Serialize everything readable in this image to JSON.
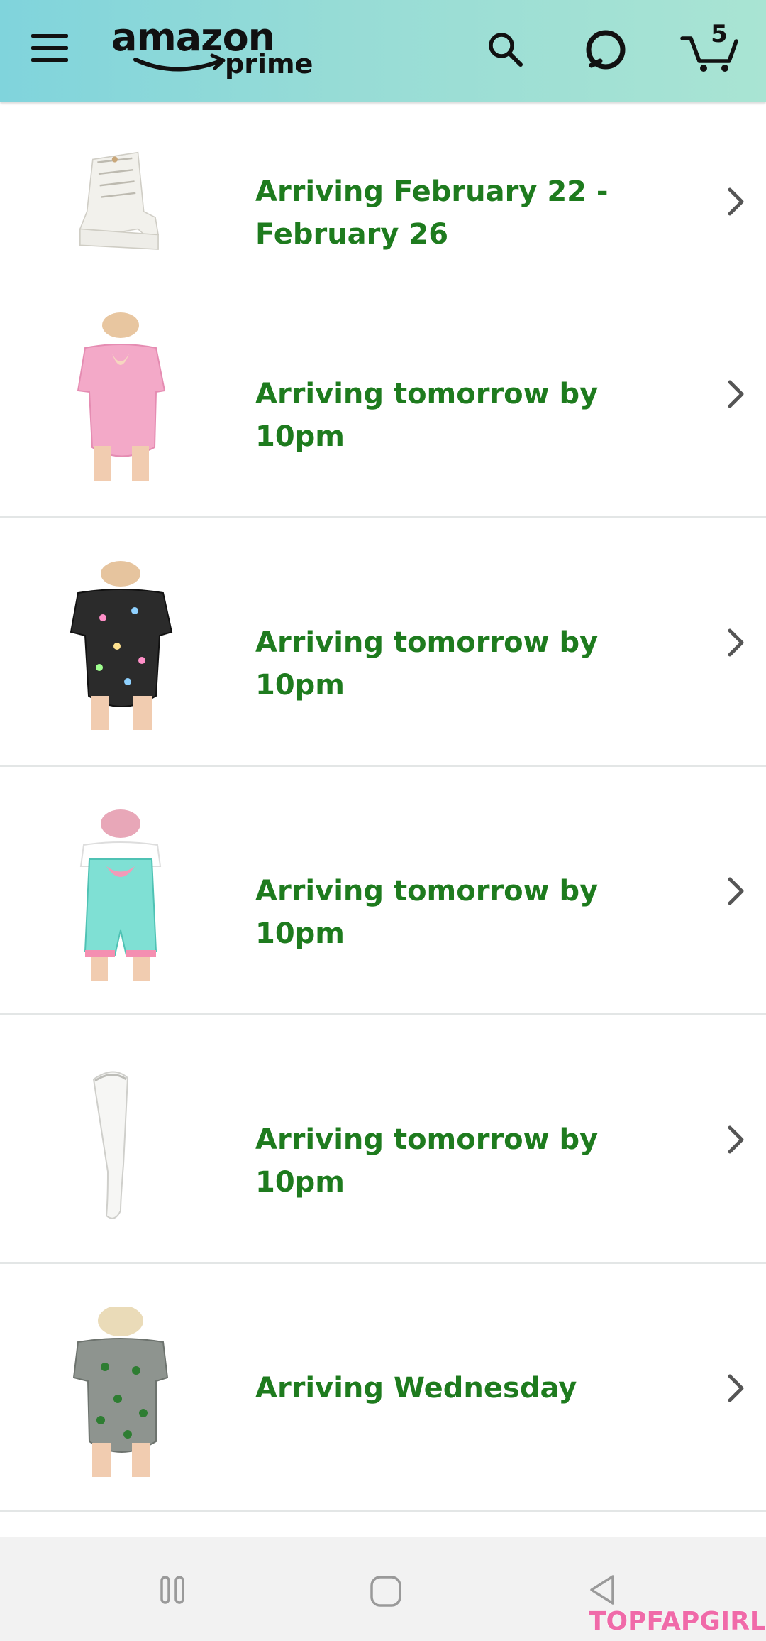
{
  "app": {
    "logo_main": "amazon",
    "logo_sub": "prime",
    "cart_count": "5",
    "brand_colors": {
      "header_start": "#80d4dc",
      "header_end": "#a9e4d3",
      "status_green": "#1e7b1e"
    }
  },
  "header": {
    "menu_icon": "hamburger-menu-icon",
    "search_icon": "search-icon",
    "alexa_icon": "alexa-icon",
    "cart_icon": "cart-icon"
  },
  "orders": [
    {
      "status": "Arriving February 22 - February 26",
      "thumb": "white-boot"
    },
    {
      "status": "Arriving tomorrow by 10pm",
      "thumb": "pink-bodysuit"
    },
    {
      "status": "Arriving tomorrow by 10pm",
      "thumb": "black-printed-bodysuit"
    },
    {
      "status": "Arriving tomorrow by 10pm",
      "thumb": "mint-overall-shorts"
    },
    {
      "status": "Arriving tomorrow by 10pm",
      "thumb": "white-stocking"
    },
    {
      "status": "Arriving Wednesday",
      "thumb": "gray-printed-bodysuit"
    }
  ],
  "navbar": {
    "recents_icon": "recents-icon",
    "home_icon": "home-icon",
    "back_icon": "back-icon"
  },
  "watermark": "TOPFAPGIRLS"
}
